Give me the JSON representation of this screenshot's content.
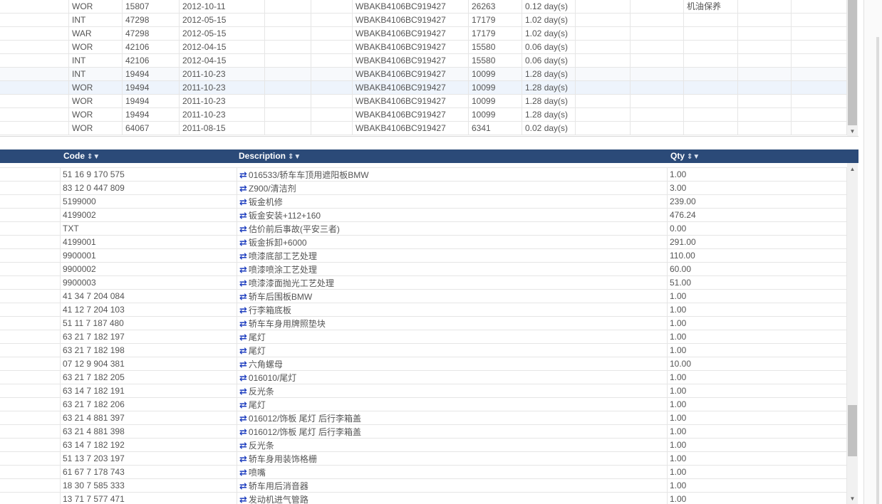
{
  "top_grid": {
    "rows": [
      {
        "type": "WOR",
        "num": "15807",
        "date": "2012-10-11",
        "vin": "WBAKB4106BC919427",
        "mileage": "26263",
        "duration": "0.12 day(s)",
        "note": "机油保养"
      },
      {
        "type": "INT",
        "num": "47298",
        "date": "2012-05-15",
        "vin": "WBAKB4106BC919427",
        "mileage": "17179",
        "duration": "1.02 day(s)",
        "note": ""
      },
      {
        "type": "WAR",
        "num": "47298",
        "date": "2012-05-15",
        "vin": "WBAKB4106BC919427",
        "mileage": "17179",
        "duration": "1.02 day(s)",
        "note": ""
      },
      {
        "type": "WOR",
        "num": "42106",
        "date": "2012-04-15",
        "vin": "WBAKB4106BC919427",
        "mileage": "15580",
        "duration": "0.06 day(s)",
        "note": ""
      },
      {
        "type": "INT",
        "num": "42106",
        "date": "2012-04-15",
        "vin": "WBAKB4106BC919427",
        "mileage": "15580",
        "duration": "0.06 day(s)",
        "note": ""
      },
      {
        "type": "INT",
        "num": "19494",
        "date": "2011-10-23",
        "vin": "WBAKB4106BC919427",
        "mileage": "10099",
        "duration": "1.28 day(s)",
        "note": ""
      },
      {
        "type": "WOR",
        "num": "19494",
        "date": "2011-10-23",
        "vin": "WBAKB4106BC919427",
        "mileage": "10099",
        "duration": "1.28 day(s)",
        "note": ""
      },
      {
        "type": "WOR",
        "num": "19494",
        "date": "2011-10-23",
        "vin": "WBAKB4106BC919427",
        "mileage": "10099",
        "duration": "1.28 day(s)",
        "note": ""
      },
      {
        "type": "WOR",
        "num": "19494",
        "date": "2011-10-23",
        "vin": "WBAKB4106BC919427",
        "mileage": "10099",
        "duration": "1.28 day(s)",
        "note": ""
      },
      {
        "type": "WOR",
        "num": "64067",
        "date": "2011-08-15",
        "vin": "WBAKB4106BC919427",
        "mileage": "6341",
        "duration": "0.02 day(s)",
        "note": ""
      }
    ]
  },
  "bottom_grid": {
    "headers": {
      "code": "Code",
      "description": "Description",
      "qty": "Qty"
    },
    "sort_glyph": "⇕▼",
    "swap_glyph": "⇄",
    "rows": [
      {
        "code": "51 16 9 170 575",
        "desc": "016533/轿车车顶用遮阳板BMW",
        "qty": "1.00"
      },
      {
        "code": "83 12 0 447 809",
        "desc": "Z900/清洁剂",
        "qty": "3.00"
      },
      {
        "code": "5199000",
        "desc": "钣金机修",
        "qty": "239.00"
      },
      {
        "code": "4199002",
        "desc": "钣金安装+112+160",
        "qty": "476.24"
      },
      {
        "code": "TXT",
        "desc": "估价前后事故(平安三者)",
        "qty": "0.00"
      },
      {
        "code": "4199001",
        "desc": "钣金拆卸+6000",
        "qty": "291.00"
      },
      {
        "code": "9900001",
        "desc": "喷漆底部工艺处理",
        "qty": "110.00"
      },
      {
        "code": "9900002",
        "desc": "喷漆喷涂工艺处理",
        "qty": "60.00"
      },
      {
        "code": "9900003",
        "desc": "喷漆漆面抛光工艺处理",
        "qty": "51.00"
      },
      {
        "code": "41 34 7 204 084",
        "desc": "轿车后围板BMW",
        "qty": "1.00"
      },
      {
        "code": "41 12 7 204 103",
        "desc": "行李箱底板",
        "qty": "1.00"
      },
      {
        "code": "51 11 7 187 480",
        "desc": "轿车车身用牌照垫块",
        "qty": "1.00"
      },
      {
        "code": "63 21 7 182 197",
        "desc": "尾灯",
        "qty": "1.00"
      },
      {
        "code": "63 21 7 182 198",
        "desc": "尾灯",
        "qty": "1.00"
      },
      {
        "code": "07 12 9 904 381",
        "desc": "六角螺母",
        "qty": "10.00"
      },
      {
        "code": "63 21 7 182 205",
        "desc": "016010/尾灯",
        "qty": "1.00"
      },
      {
        "code": "63 14 7 182 191",
        "desc": "反光条",
        "qty": "1.00"
      },
      {
        "code": "63 21 7 182 206",
        "desc": "尾灯",
        "qty": "1.00"
      },
      {
        "code": "63 21 4 881 397",
        "desc": "016012/饰板 尾灯 后行李箱盖",
        "qty": "1.00"
      },
      {
        "code": "63 21 4 881 398",
        "desc": "016012/饰板 尾灯 后行李箱盖",
        "qty": "1.00"
      },
      {
        "code": "63 14 7 182 192",
        "desc": "反光条",
        "qty": "1.00"
      },
      {
        "code": "51 13 7 203 197",
        "desc": "轿车身用装饰格栅",
        "qty": "1.00"
      },
      {
        "code": "61 67 7 178 743",
        "desc": "喷嘴",
        "qty": "1.00"
      },
      {
        "code": "18 30 7 585 333",
        "desc": "轿车用后消音器",
        "qty": "1.00"
      },
      {
        "code": "13 71 7 577 471",
        "desc": "发动机进气管路",
        "qty": "1.00"
      }
    ]
  }
}
